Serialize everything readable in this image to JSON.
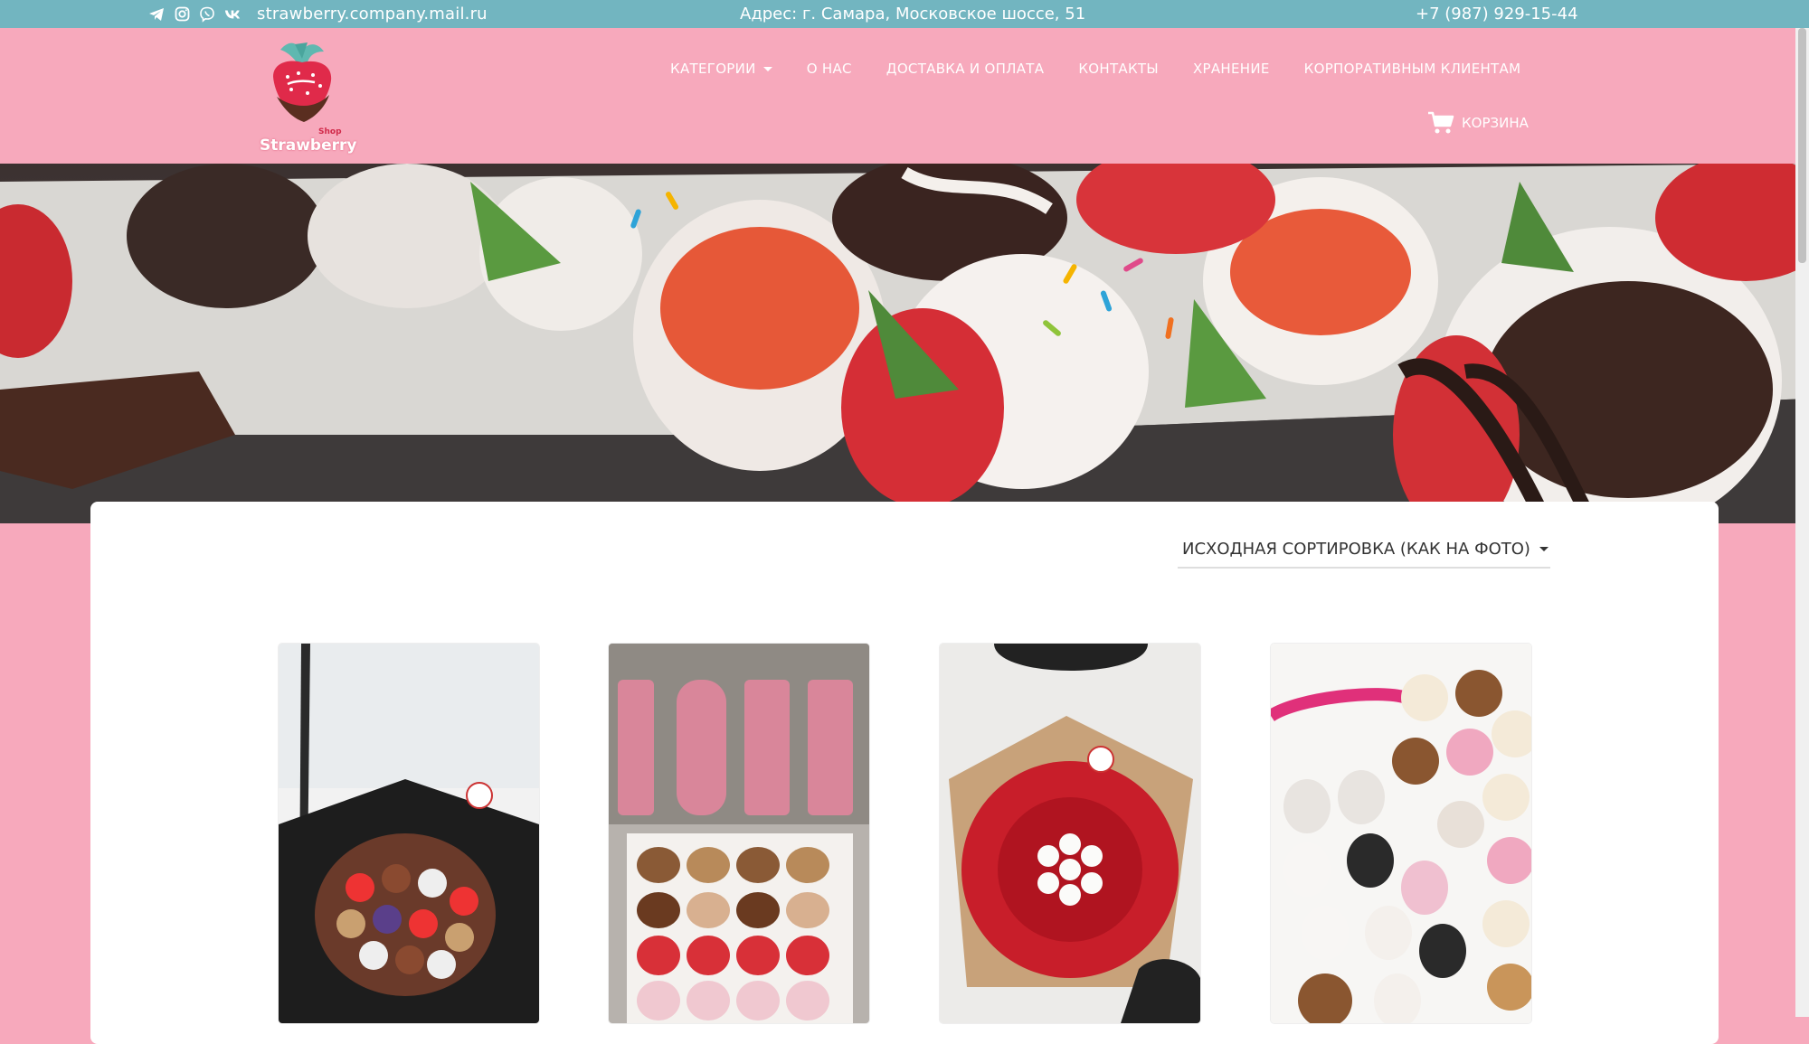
{
  "topbar": {
    "social_icons": [
      "telegram-icon",
      "instagram-icon",
      "viber-icon",
      "vk-icon"
    ],
    "email": "strawberry.company.mail.ru",
    "address": "Адрес: г. Самара, Московское шоссе, 51",
    "phone": "+7 (987) 929-15-44"
  },
  "header": {
    "logo_brand": "Strawberry",
    "logo_shop": "Shop",
    "nav": [
      {
        "label": "КАТЕГОРИИ",
        "has_caret": true
      },
      {
        "label": "О НАС"
      },
      {
        "label": "ДОСТАВКА И ОПЛАТА"
      },
      {
        "label": "КОНТАКТЫ"
      },
      {
        "label": "ХРАНЕНИЕ"
      },
      {
        "label": "КОРПОРАТИВНЫМ КЛИЕНТАМ"
      }
    ],
    "cart_label": "КОРЗИНА"
  },
  "content": {
    "sort_label": "ИСХОДНАЯ СОРТИРОВКА (КАК НА ФОТО)"
  },
  "colors": {
    "topbar": "#72b5c0",
    "header_bg": "#f7a9bc",
    "panel": "#ffffff"
  }
}
